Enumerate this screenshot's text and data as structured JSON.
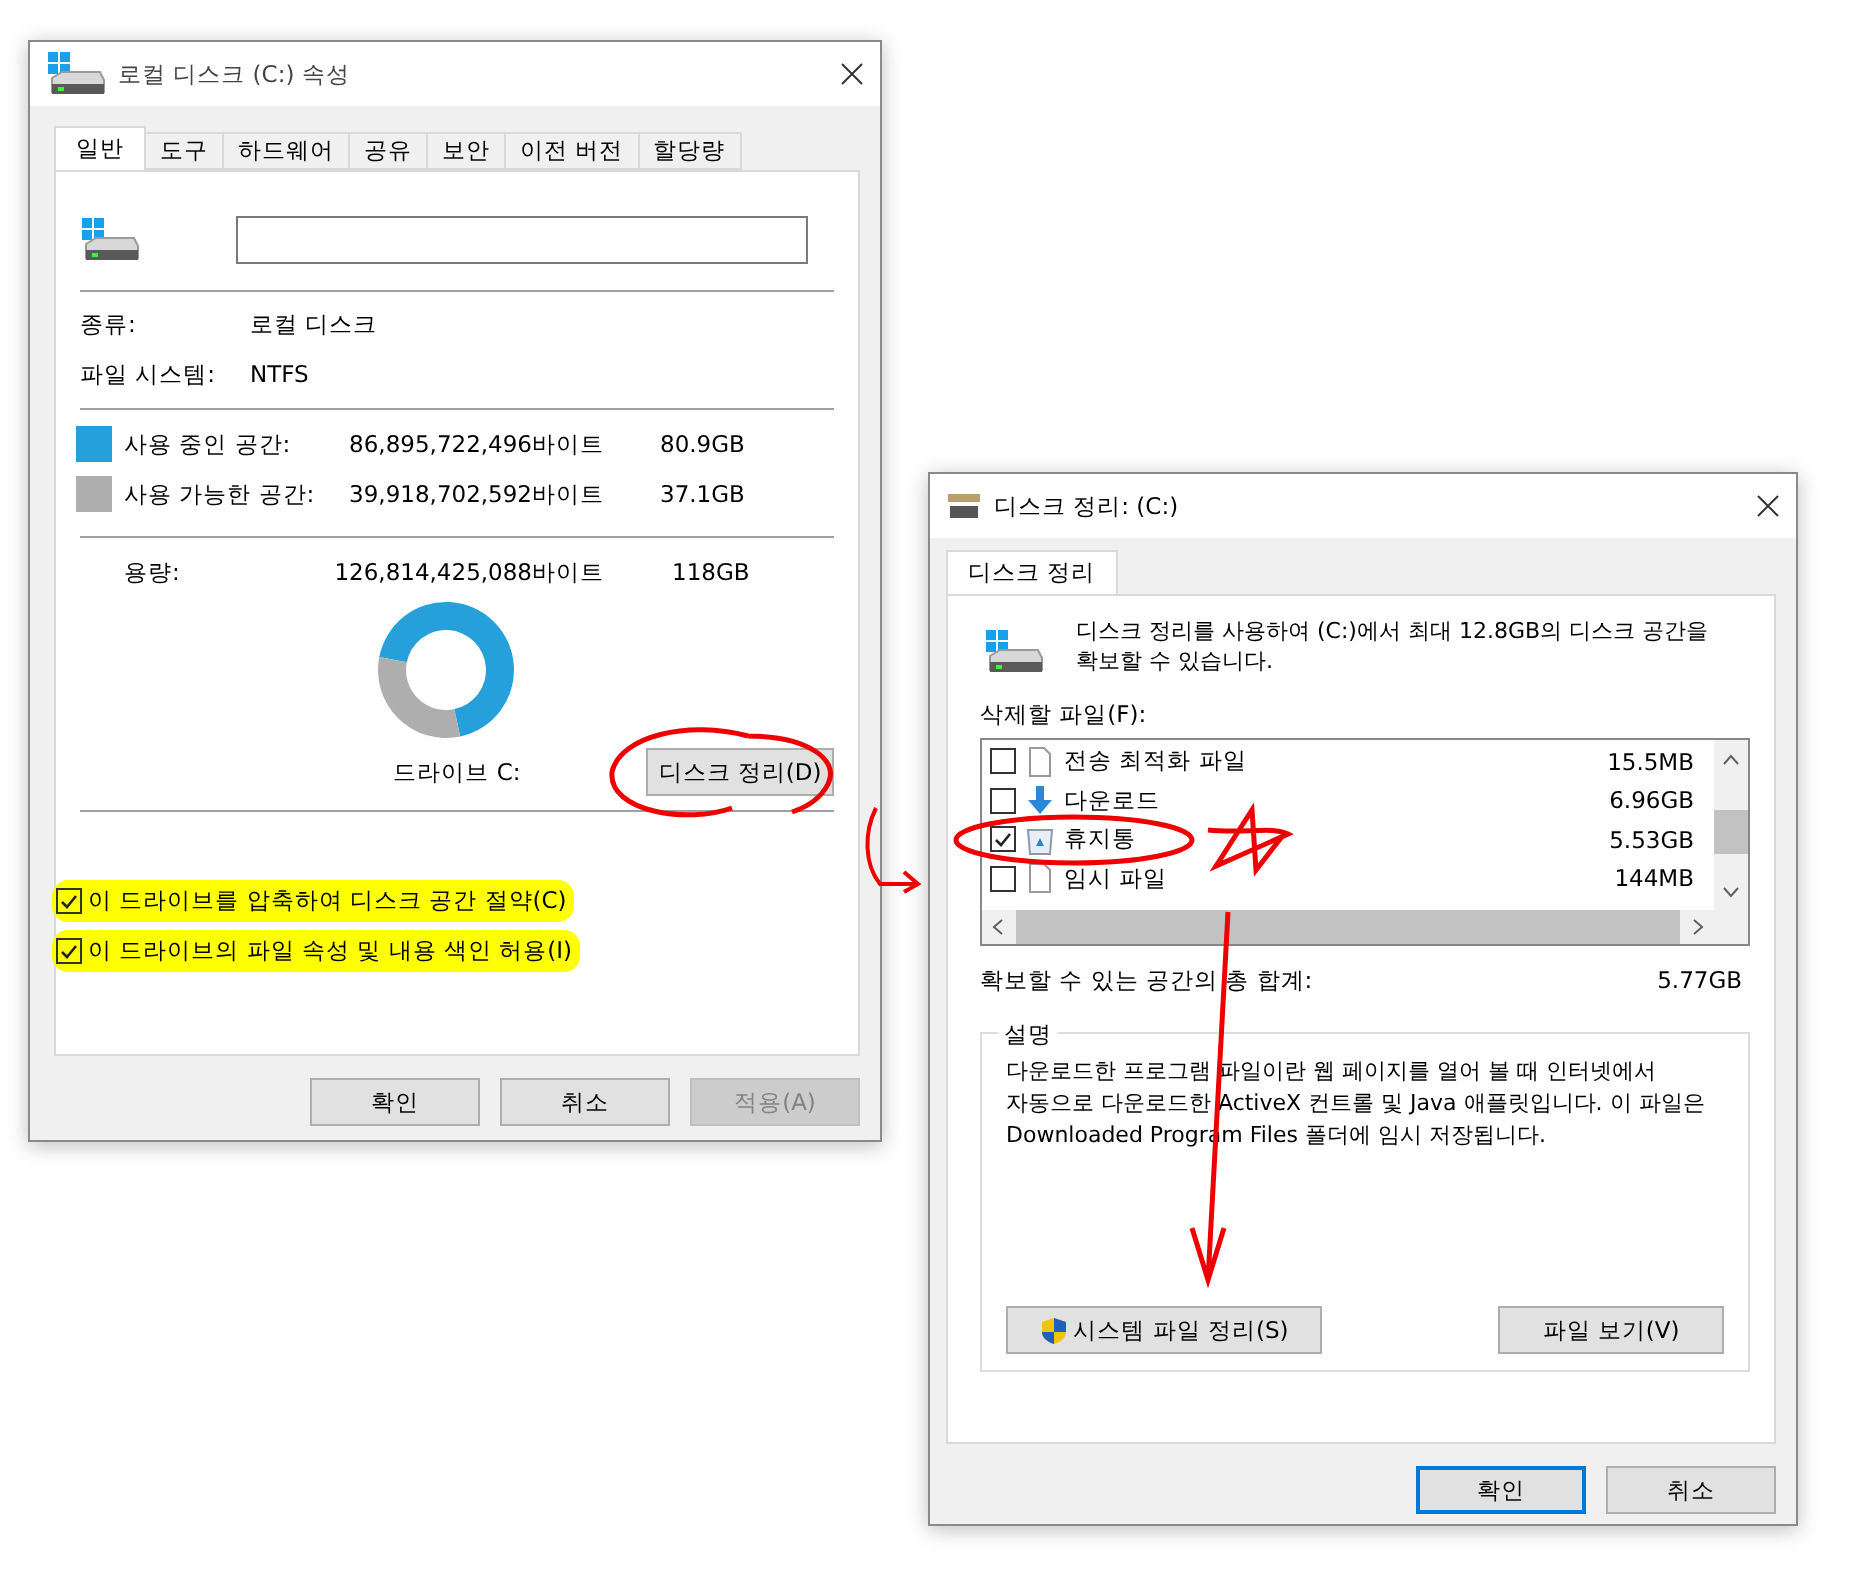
{
  "properties_window": {
    "title": "로컬 디스크 (C:) 속성",
    "tabs": [
      {
        "label": "일반",
        "selected": true
      },
      {
        "label": "도구",
        "selected": false
      },
      {
        "label": "하드웨어",
        "selected": false
      },
      {
        "label": "공유",
        "selected": false
      },
      {
        "label": "보안",
        "selected": false
      },
      {
        "label": "이전 버전",
        "selected": false
      },
      {
        "label": "할당량",
        "selected": false
      }
    ],
    "info": [
      {
        "label": "종류:",
        "value": "로컬 디스크"
      },
      {
        "label": "파일 시스템:",
        "value": "NTFS"
      }
    ],
    "space": [
      {
        "label": "사용 중인 공간:",
        "bytes": "86,895,722,496바이트",
        "size": "80.9GB",
        "color": "#26a0da"
      },
      {
        "label": "사용 가능한 공간:",
        "bytes": "39,918,702,592바이트",
        "size": "37.1GB",
        "color": "#aeaeae"
      }
    ],
    "capacity": {
      "label": "용량:",
      "bytes": "126,814,425,088바이트",
      "size": "118GB"
    },
    "chart_data": {
      "type": "donut",
      "values": [
        68.6,
        31.4
      ]
    },
    "drive_label": "드라이브 C:",
    "cleanup_button": "디스크 정리(D)",
    "options": [
      {
        "label": "이 드라이브를 압축하여 디스크 공간 절약(C)",
        "checked": true
      },
      {
        "label": "이 드라이브의 파일 속성 및 내용 색인 허용(I)",
        "checked": true
      }
    ],
    "buttons": [
      {
        "label": "확인",
        "disabled": false
      },
      {
        "label": "취소",
        "disabled": false
      },
      {
        "label": "적용(A)",
        "disabled": true
      }
    ]
  },
  "cleanup_window": {
    "title": "디스크 정리: (C:)",
    "tabs": [
      {
        "label": "디스크 정리",
        "selected": true
      }
    ],
    "intro": "디스크 정리를 사용하여 (C:)에서 최대 12.8GB의 디스크 공간을 확보할 수 있습니다.",
    "files_label": "삭제할 파일(F):",
    "files": [
      {
        "name": "전송 최적화 파일",
        "size": "15.5MB",
        "checked": false,
        "kind": "document"
      },
      {
        "name": "다운로드",
        "size": "6.96GB",
        "checked": false,
        "kind": "download"
      },
      {
        "name": "휴지통",
        "size": "5.53GB",
        "checked": true,
        "kind": "recycle"
      },
      {
        "name": "임시 파일",
        "size": "144MB",
        "checked": false,
        "kind": "document"
      }
    ],
    "total_label": "확보할 수 있는 공간의 총 합계:",
    "total": "5.77GB",
    "description_title": "설명",
    "description": "다운로드한 프로그램 파일이란 웹 페이지를 열어 볼 때 인터넷에서 자동으로 다운로드한 ActiveX 컨트롤 및 Java 애플릿입니다. 이 파일은 Downloaded Program Files 폴더에 임시 저장됩니다.",
    "system_button": "시스템 파일 정리(S)",
    "view_button": "파일 보기(V)",
    "buttons": [
      {
        "label": "확인",
        "default": true
      },
      {
        "label": "취소",
        "default": false
      }
    ]
  }
}
